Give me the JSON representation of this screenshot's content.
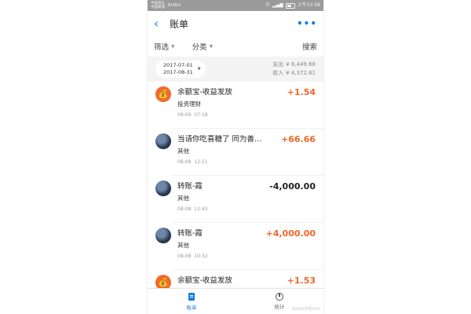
{
  "status_bar": {
    "carrier_line1": "中国电信",
    "carrier_line2": "中国联通",
    "net_speed": "303B/s",
    "time": "上午10:58"
  },
  "header": {
    "back_icon": "‹",
    "title": "账单",
    "more_icon": "•••"
  },
  "filters": {
    "filter_label": "筛选",
    "category_label": "分类",
    "search_label": "搜索"
  },
  "summary": {
    "date_start": "2017-07-01",
    "date_end": "2017-08-31",
    "expense_label": "支出",
    "expense_value": "¥ 6,449.68",
    "income_label": "收入",
    "income_value": "¥ 4,372.61"
  },
  "transactions": [
    {
      "avatar": "yuebao",
      "title": "余额宝-收益发放",
      "category": "投资理财",
      "date": "08-09",
      "time": "07:18",
      "amount": "+1.54",
      "type": "income"
    },
    {
      "avatar": "photo",
      "title": "当请你吃喜糖了 同为善…",
      "category": "其他",
      "date": "08-08",
      "time": "12:51",
      "amount": "+66.66",
      "type": "income"
    },
    {
      "avatar": "photo",
      "title": "转账-霞",
      "category": "其他",
      "date": "08-08",
      "time": "12:43",
      "amount": "-4,000.00",
      "type": "expense"
    },
    {
      "avatar": "photo",
      "title": "转账-霞",
      "category": "其他",
      "date": "08-08",
      "time": "10:32",
      "amount": "+4,000.00",
      "type": "income"
    },
    {
      "avatar": "yuebao",
      "title": "余额宝-收益发放",
      "amount": "+1.53",
      "type": "income"
    }
  ],
  "bottom_nav": {
    "bill_label": "账单",
    "stats_label": "统计"
  },
  "watermark": "SmackMoon",
  "colors": {
    "accent": "#1a7fe0",
    "income": "#f0652a",
    "expense": "#222222",
    "avatar_yuebao": "#f26b2c"
  }
}
